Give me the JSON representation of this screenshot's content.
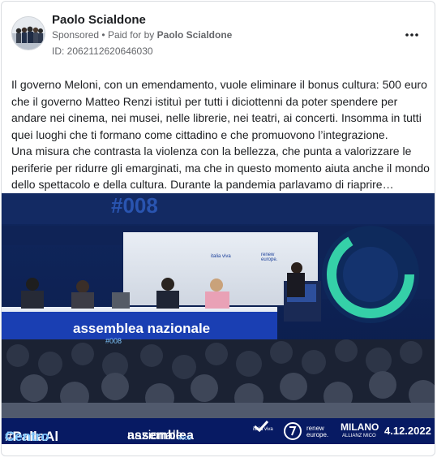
{
  "post": {
    "page_name": "Paolo Scialdone",
    "sponsored": "Sponsored",
    "separator": "•",
    "paid_for_prefix": "Paid for by",
    "paid_for_name": "Paolo Scialdone",
    "ad_id": "ID: 2062112620646030",
    "more_icon": "more-horizontal-icon",
    "paragraph_1": "Il governo Meloni, con un emendamento, vuole eliminare il bonus cultura: 500 euro che il governo Matteo Renzi istituì per tutti i diciottenni da poter spendere per andare nei cinema, nei musei, nelle librerie, nei teatri, ai concerti. Insomma in tutti quei luoghi che ti formano come cittadino e che promuovono l’integrazione.",
    "paragraph_2": "Una misura che contrasta la violenza con la bellezza, che punta a valorizzare le periferie per ridurre gli emarginati, ma che in questo momento aiuta anche il mondo dello spettacolo e della cultura. Durante la pandemia parlavamo di riaprire…"
  },
  "media": {
    "event_tag": "#008",
    "stage_sign": "assemblea nazionale",
    "stage_sign_sub": "#008",
    "logo_1": "italia viva",
    "logo_2": "renew europe.",
    "banner": {
      "hashtag_part1": "#PallaAl",
      "hashtag_part2": "Centro",
      "assembly_part1": "assemblea",
      "assembly_part2": "nazionale",
      "assembly_sub": "#008",
      "party": "italia viva",
      "renew": "renew europe.",
      "city": "MILANO",
      "venue": "ALLIANZ MICO",
      "date": "4.12.2022"
    }
  },
  "colors": {
    "primary_text": "#1c1e21",
    "secondary_text": "#65676b",
    "banner_blue": "#071a63",
    "accent_light_blue": "#7fc6ff"
  }
}
